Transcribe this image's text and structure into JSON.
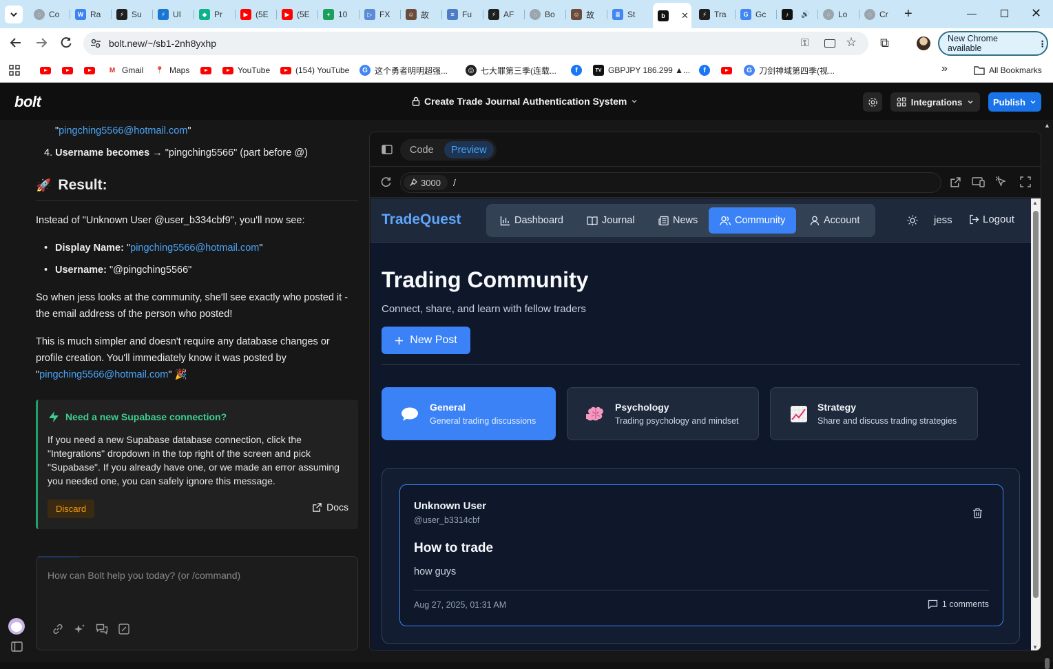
{
  "browser": {
    "tabs": [
      {
        "label": "Co",
        "icon": "globe-icon"
      },
      {
        "label": "Ra",
        "icon": "w-icon"
      },
      {
        "label": "Su",
        "icon": "supabase-icon"
      },
      {
        "label": "UI",
        "icon": "ui-icon"
      },
      {
        "label": "Pr",
        "icon": "diamond-icon"
      },
      {
        "label": "(5E",
        "icon": "youtube-icon"
      },
      {
        "label": "(5E",
        "icon": "youtube-icon"
      },
      {
        "label": "10",
        "icon": "plus-icon"
      },
      {
        "label": "FX",
        "icon": "play-icon"
      },
      {
        "label": "故",
        "icon": "avatar-icon"
      },
      {
        "label": "Fu",
        "icon": "lines-icon"
      },
      {
        "label": "AF",
        "icon": "supabase-icon"
      },
      {
        "label": "Bo",
        "icon": "globe-icon"
      },
      {
        "label": "故",
        "icon": "avatar-icon"
      },
      {
        "label": "St",
        "icon": "docs-icon"
      },
      {
        "label": "",
        "icon": "bolt-icon"
      },
      {
        "label": "Tra",
        "icon": "supabase-icon"
      },
      {
        "label": "Gc",
        "icon": "translate-icon"
      },
      {
        "label": "",
        "icon": "tiktok-icon"
      },
      {
        "label": "Lo",
        "icon": "globe-icon"
      },
      {
        "label": "Cr",
        "icon": "globe-icon"
      }
    ],
    "url": "bolt.new/~/sb1-2nh8yxhp",
    "chrome_update": "New Chrome available",
    "bookmarks": [
      {
        "label": "",
        "icon": "youtube-icon"
      },
      {
        "label": "",
        "icon": "youtube-icon"
      },
      {
        "label": "",
        "icon": "youtube-icon"
      },
      {
        "label": "Gmail",
        "icon": "gmail-icon"
      },
      {
        "label": "Maps",
        "icon": "maps-icon"
      },
      {
        "label": "",
        "icon": "youtube-icon"
      },
      {
        "label": "YouTube",
        "icon": "youtube-icon"
      },
      {
        "label": "(154) YouTube",
        "icon": "youtube-icon"
      },
      {
        "label": "这个勇者明明超强...",
        "icon": "translate-icon"
      },
      {
        "label": "七大罪第三季(连载...",
        "icon": "circle-icon"
      },
      {
        "label": "",
        "icon": "facebook-icon"
      },
      {
        "label": "GBPJPY 186.299 ▲...",
        "icon": "tv-icon"
      },
      {
        "label": "",
        "icon": "facebook-icon"
      },
      {
        "label": "",
        "icon": "youtube-icon"
      },
      {
        "label": "刀剑神域第四季(视...",
        "icon": "translate-icon"
      }
    ],
    "all_bookmarks": "All Bookmarks",
    "more_bookmarks": "»"
  },
  "bolt": {
    "logo": "bolt",
    "project_title": "Create Trade Journal Authentication System",
    "integrations_label": "Integrations",
    "publish_label": "Publish"
  },
  "chat": {
    "email_top": "pingching5566@hotmail.com",
    "quote": "\"",
    "step4_prefix": "4.",
    "step4_bold": "Username becomes",
    "step4_arrow": " → ",
    "step4_rest": "\"pingching5566\" (part before @)",
    "result_heading": "Result:",
    "result_intro": "Instead of \"Unknown User @user_b334cbf9\", you'll now see:",
    "bullet1_label": "Display Name:",
    "bullet1_open": " \"",
    "bullet1_link": "pingching5566@hotmail.com",
    "bullet1_close": "\"",
    "bullet2_label": "Username:",
    "bullet2_value": " \"@pingching5566\"",
    "para1": "So when jess looks at the community, she'll see exactly who posted it - the email address of the person who posted!",
    "para2": "This is much simpler and doesn't require any database changes or profile creation. You'll immediately know it was posted by",
    "para2_open": "\"",
    "para2_link": "pingching5566@hotmail.com",
    "para2_close": "\" 🎉",
    "notice_title": "Need a new Supabase connection?",
    "notice_body": "If you need a new Supabase database connection, click the \"Integrations\" dropdown in the top right of the screen and pick \"Supabase\". If you already have one, or we made an error assuming you needed one, you can safely ignore this message.",
    "discard_label": "Discard",
    "docs_label": "Docs",
    "composer_placeholder": "How can Bolt help you today? (or /command)"
  },
  "preview": {
    "tab_code": "Code",
    "tab_preview": "Preview",
    "port": "3000",
    "path": "/"
  },
  "site": {
    "brand": "TradeQuest",
    "nav": {
      "dashboard": "Dashboard",
      "journal": "Journal",
      "news": "News",
      "community": "Community",
      "account": "Account"
    },
    "user": "jess",
    "logout": "Logout",
    "title": "Trading Community",
    "subtitle": "Connect, share, and learn with fellow traders",
    "new_post": "New Post",
    "categories": [
      {
        "title": "General",
        "desc": "General trading discussions",
        "icon": "speech-bubble-icon",
        "active": true
      },
      {
        "title": "Psychology",
        "desc": "Trading psychology and mindset",
        "icon": "brain-icon",
        "active": false
      },
      {
        "title": "Strategy",
        "desc": "Share and discuss trading strategies",
        "icon": "chart-icon",
        "active": false
      }
    ],
    "post": {
      "author": "Unknown User",
      "handle": "@user_b3314cbf",
      "title": "How to trade",
      "body": "how guys",
      "date": "Aug 27, 2025, 01:31 AM",
      "comments": "1 comments"
    }
  },
  "colors": {
    "accent_blue": "#3b82f6",
    "bolt_publish": "#1a73e8",
    "link": "#4aa3f5",
    "supabase_green": "#22a06b",
    "site_bg": "#0f172a"
  }
}
